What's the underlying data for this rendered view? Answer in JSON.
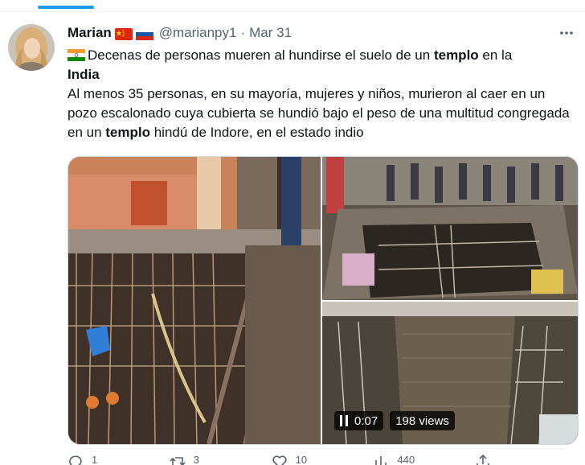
{
  "tweet": {
    "author_name": "Marian",
    "handle": "@marianpy1",
    "date": "Mar 31",
    "text": {
      "line1_before": "Decenas de personas mueren al hundirse el suelo de un ",
      "line1_bold": "templo",
      "line1_after": " en la",
      "line2_bold": "India",
      "para_before": "Al menos 35 personas, en su mayoría, mujeres y niños, murieron al caer en un pozo escalonado cuya cubierta se hundió bajo el peso de una multitud congregada en un ",
      "para_bold": "templo",
      "para_after": " hindú de Indore, en el estado indio"
    },
    "video": {
      "time": "0:07",
      "views": "198 views"
    },
    "actions": {
      "replies": "1",
      "retweets": "3",
      "likes": "10",
      "views": "440"
    },
    "icons": {
      "avatar": "avatar-photo",
      "flag_china": "china-flag-icon",
      "flag_russia": "russia-flag-icon",
      "flag_india": "india-flag-icon",
      "more": "more-dots-icon",
      "pause": "pause-icon",
      "reply": "reply-icon",
      "retweet": "retweet-icon",
      "like": "heart-icon",
      "views": "views-chart-icon",
      "share": "share-icon"
    },
    "colors": {
      "accent": "#1d9bf0",
      "text": "#0f1419",
      "secondary": "#536471"
    }
  }
}
